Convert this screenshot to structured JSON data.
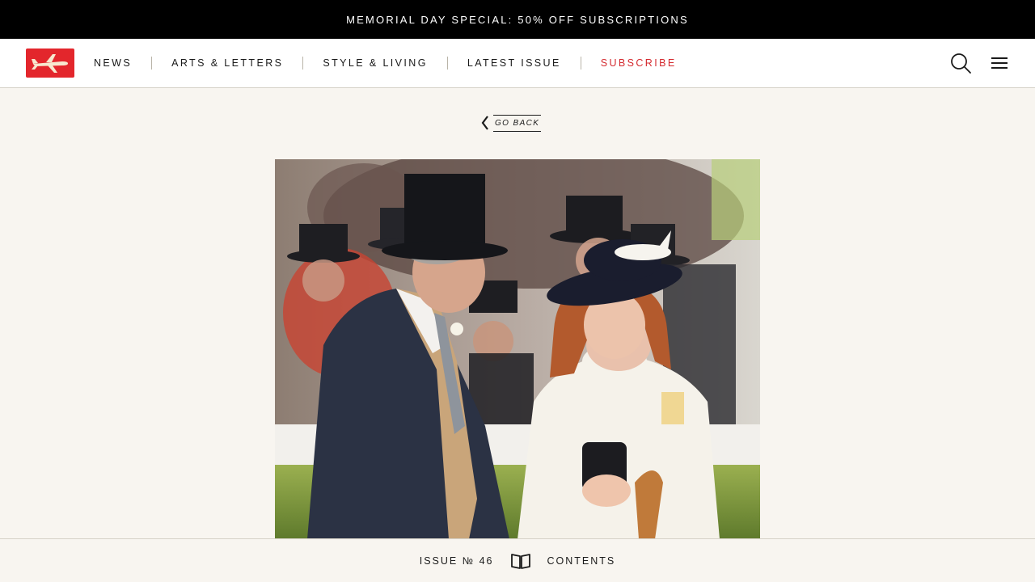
{
  "promo": {
    "text": "MEMORIAL DAY SPECIAL: 50% OFF SUBSCRIPTIONS"
  },
  "nav": {
    "logo_icon": "airplane-logo-icon",
    "links": [
      "NEWS",
      "ARTS & LETTERS",
      "STYLE & LIVING",
      "LATEST ISSUE"
    ],
    "subscribe": "SUBSCRIBE",
    "search_icon": "search-icon",
    "menu_icon": "hamburger-menu-icon"
  },
  "back": {
    "label": "GO BACK",
    "icon": "chevron-left-icon"
  },
  "footer": {
    "issue": "ISSUE № 46",
    "book_icon": "open-book-icon",
    "contents": "CONTENTS"
  },
  "colors": {
    "brand_red": "#e3262c",
    "subscribe_red": "#d42a2f",
    "background": "#f8f5f0",
    "promo_bg": "#000000"
  }
}
